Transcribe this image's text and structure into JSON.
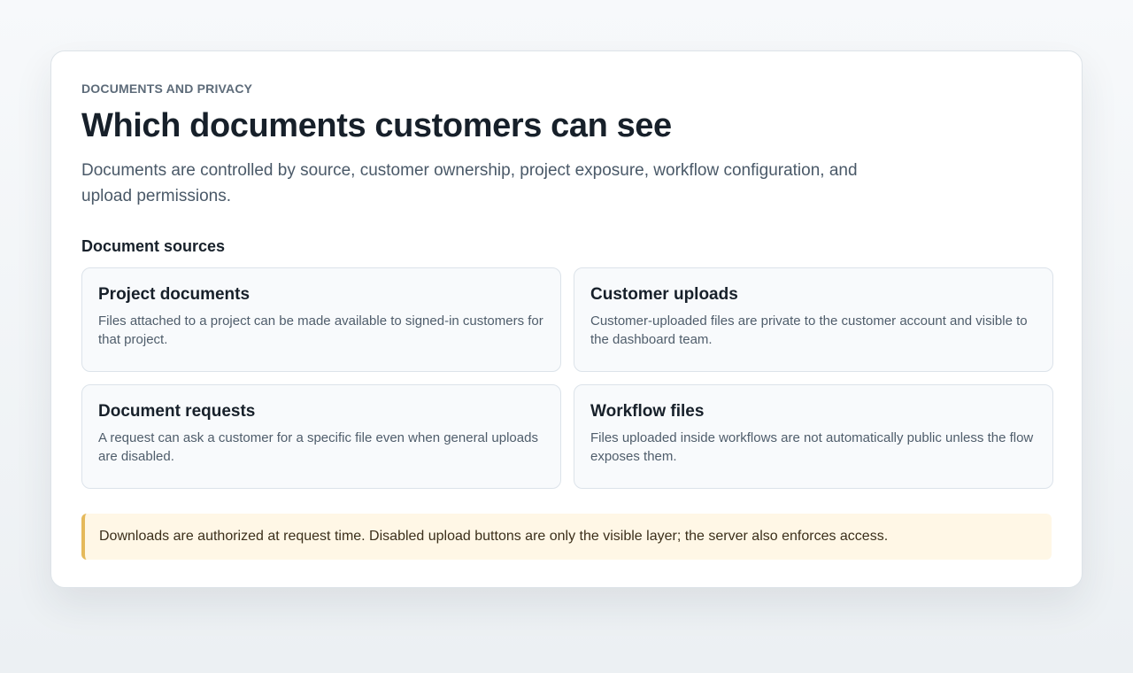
{
  "header": {
    "eyebrow": "DOCUMENTS AND PRIVACY",
    "title": "Which documents customers can see",
    "intro": "Documents are controlled by source, customer ownership, project exposure, workflow configuration, and upload permissions."
  },
  "sources": {
    "heading": "Document sources",
    "items": [
      {
        "title": "Project documents",
        "description": "Files attached to a project can be made available to signed-in customers for that project."
      },
      {
        "title": "Customer uploads",
        "description": "Customer-uploaded files are private to the customer account and visible to the dashboard team."
      },
      {
        "title": "Document requests",
        "description": "A request can ask a customer for a specific file even when general uploads are disabled."
      },
      {
        "title": "Workflow files",
        "description": "Files uploaded inside workflows are not automatically public unless the flow exposes them."
      }
    ]
  },
  "notice": {
    "text": "Downloads are authorized at request time. Disabled upload buttons are only the visible layer; the server also enforces access."
  },
  "colors": {
    "notice_background": "#fff7e6",
    "notice_accent": "#e5b95a",
    "card_background": "#ffffff",
    "source_card_background": "#f8fafc"
  }
}
